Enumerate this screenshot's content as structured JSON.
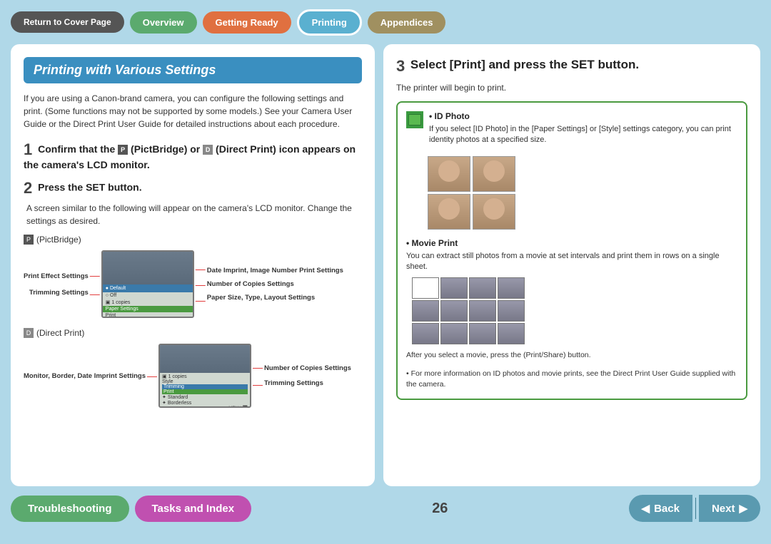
{
  "nav": {
    "return_label": "Return to Cover Page",
    "overview_label": "Overview",
    "getting_ready_label": "Getting Ready",
    "printing_label": "Printing",
    "appendices_label": "Appendices"
  },
  "left": {
    "title": "Printing with Various Settings",
    "intro": "If you are using a Canon-brand camera, you can configure the following settings and print. (Some functions may not be supported by some models.) See your Camera User Guide or the Direct Print User Guide for detailed instructions about each procedure.",
    "step1_number": "1",
    "step1_text": "Confirm that the   (PictBridge) or   (Direct Print) icon appears on the camera's LCD monitor.",
    "step2_number": "2",
    "step2_title": "Press the SET button.",
    "step2_sub": "A screen similar to the following will appear on the camera's LCD monitor. Change the settings as desired.",
    "pictbridge_label": "(PictBridge)",
    "left_label1": "Print Effect Settings",
    "left_label2": "Trimming Settings",
    "right_label1": "Date Imprint, Image Number Print Settings",
    "right_label2": "Number of Copies Settings",
    "right_label3": "Paper Size, Type, Layout Settings",
    "direct_print_label": "(Direct Print)",
    "left_label3": "Monitor, Border, Date Imprint Settings",
    "right_label4": "Number of Copies Settings",
    "right_label5": "Trimming Settings"
  },
  "right": {
    "step3_number": "3",
    "step3_title": "Select [Print] and press the SET button.",
    "step3_sub": "The printer will begin to print.",
    "id_photo_title": "ID Photo",
    "id_photo_text": "If you select [ID Photo] in the [Paper Settings] or [Style] settings category, you can print identity photos at a specified size.",
    "movie_print_title": "Movie Print",
    "movie_print_text": "You can extract still photos from a movie at set intervals and print them in rows on a single sheet.",
    "movie_note": "After you select a movie, press the    (Print/Share) button.",
    "footer_note": "• For more information on ID photos and movie prints, see the Direct Print User Guide supplied with the camera."
  },
  "bottom": {
    "troubleshoot_label": "Troubleshooting",
    "tasks_label": "Tasks and Index",
    "page_number": "26",
    "back_label": "Back",
    "next_label": "Next"
  }
}
